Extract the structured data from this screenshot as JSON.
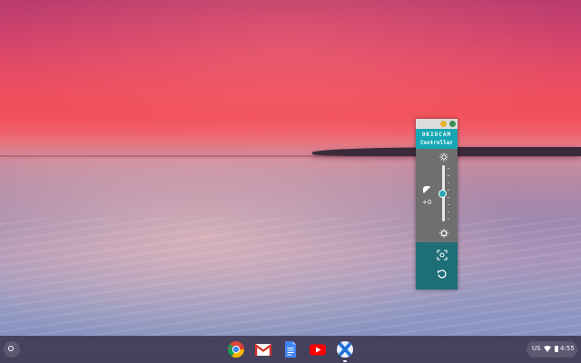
{
  "controller": {
    "brand": "OKIOCAM",
    "title": "Controller",
    "exposure_value": "+0",
    "slider_level": 0.5
  },
  "shelf": {
    "apps": [
      "chrome-icon",
      "gmail-icon",
      "docs-icon",
      "youtube-icon",
      "okiocam-icon"
    ],
    "status": {
      "language": "US",
      "time": "4:55"
    }
  },
  "colors": {
    "controller_accent": "#16a6b4",
    "controller_panel": "#1e6e77",
    "controller_body": "#6f6f6f"
  }
}
